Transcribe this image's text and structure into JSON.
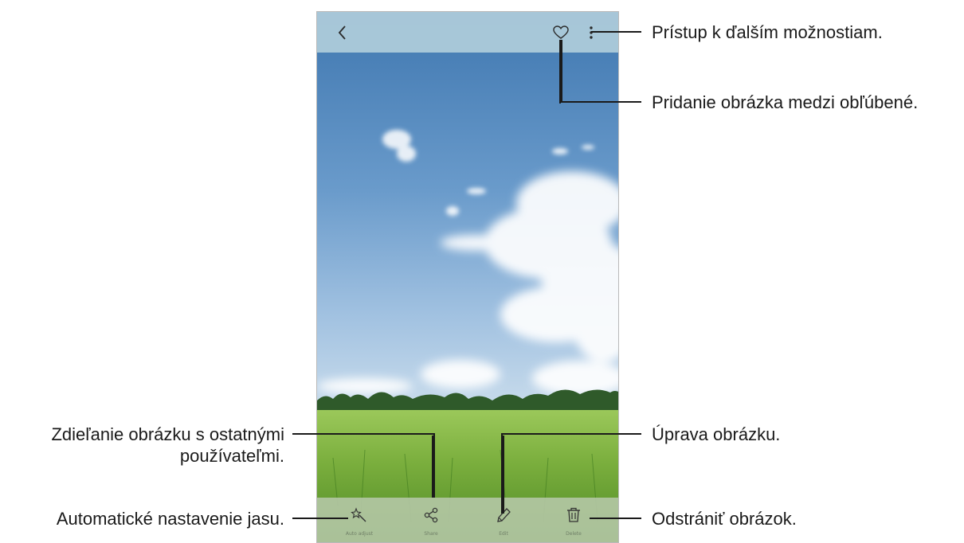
{
  "toolbar": {
    "back_icon": "chevron-left-icon",
    "favorite_icon": "heart-icon",
    "more_icon": "more-vertical-icon"
  },
  "bottom_bar": {
    "auto_adjust_label": "Auto adjust",
    "share_label": "Share",
    "edit_label": "Edit",
    "delete_label": "Delete",
    "icons": [
      "magic-wand-icon",
      "share-icon",
      "pencil-icon",
      "trash-icon"
    ]
  },
  "callouts": {
    "more_options": "Prístup k ďalším možnostiam.",
    "favorite": "Pridanie obrázka medzi obľúbené.",
    "share_line1": "Zdieľanie obrázku s ostatnými",
    "share_line2": "používateľmi.",
    "edit": "Úprava obrázku.",
    "auto_adjust": "Automatické nastavenie jasu.",
    "delete": "Odstrániť obrázok."
  },
  "colors": {
    "sky_top": "#4f82b8",
    "sky_bottom": "#b9d3ea",
    "field": "#6fa23a",
    "callout_line": "#1a1a1a"
  }
}
